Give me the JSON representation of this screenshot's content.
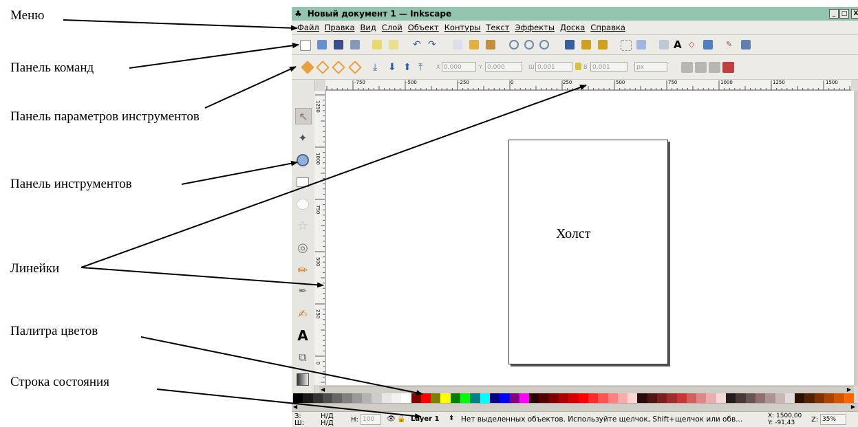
{
  "window": {
    "title": "Новый документ 1 — Inkscape",
    "title_icon": "inkscape-logo-icon",
    "buttons": [
      "_",
      "□",
      "X"
    ]
  },
  "menu": [
    "Файл",
    "Правка",
    "Вид",
    "Слой",
    "Объект",
    "Контуры",
    "Текст",
    "Эффекты",
    "Доска",
    "Справка"
  ],
  "tool_controls": {
    "x_value": "0,000",
    "y_value": "0,000",
    "w_value": "0,001",
    "h_value": "0,001",
    "unit": "px",
    "x_label": "X",
    "y_label": "Y",
    "w_label": "Ш",
    "h_label": "В"
  },
  "ruler": {
    "h_ticks": [
      "-750",
      "-500",
      "-250",
      "0",
      "250",
      "500",
      "750",
      "1000",
      "1250",
      "1500"
    ],
    "v_ticks": [
      "1250",
      "1000",
      "750",
      "500",
      "250",
      "0"
    ]
  },
  "canvas": {
    "page_label": "Холст"
  },
  "annotations": [
    "Меню",
    "Панель команд",
    "Панель параметров инструментов",
    "Панель инструментов",
    "Линейки",
    "Палитра цветов",
    "Строка состояния"
  ],
  "palette": [
    "#000000",
    "#1a1a1a",
    "#333333",
    "#4d4d4d",
    "#666666",
    "#808080",
    "#999999",
    "#b3b3b3",
    "#cccccc",
    "#e6e6e6",
    "#f2f2f2",
    "#ffffff",
    "#800000",
    "#ff0000",
    "#808000",
    "#ffff00",
    "#008000",
    "#00ff00",
    "#008080",
    "#00ffff",
    "#000080",
    "#0000ff",
    "#800080",
    "#ff00ff",
    "#2b0000",
    "#550000",
    "#800000",
    "#aa0000",
    "#d40000",
    "#ff0000",
    "#ff2a2a",
    "#ff5555",
    "#ff8080",
    "#ffaaaa",
    "#ffd5d5",
    "#280b0b",
    "#501616",
    "#782121",
    "#a02c2c",
    "#c83737",
    "#d35f5f",
    "#de8787",
    "#e9afaf",
    "#f4d7d7",
    "#241c1c",
    "#483737",
    "#6c5353",
    "#916f6f",
    "#ac9393",
    "#c8b7b7",
    "#e3dbdb",
    "#2b1100",
    "#552200",
    "#803300",
    "#aa4400",
    "#d45500",
    "#ff6600"
  ],
  "statusbar": {
    "fill_label": "З:",
    "stroke_label": "Ш:",
    "fill_value": "Н/Д",
    "stroke_value": "Н/Д",
    "h_label": "Н:",
    "h_value": "100",
    "layer": "Layer 1",
    "message": "Нет выделенных объектов. Используйте щелчок, Shift+щелчок или обв...",
    "x_coord": "X: 1500,00",
    "y_coord": "Y: -91,43",
    "zoom_label": "Z:",
    "zoom": "35%"
  }
}
